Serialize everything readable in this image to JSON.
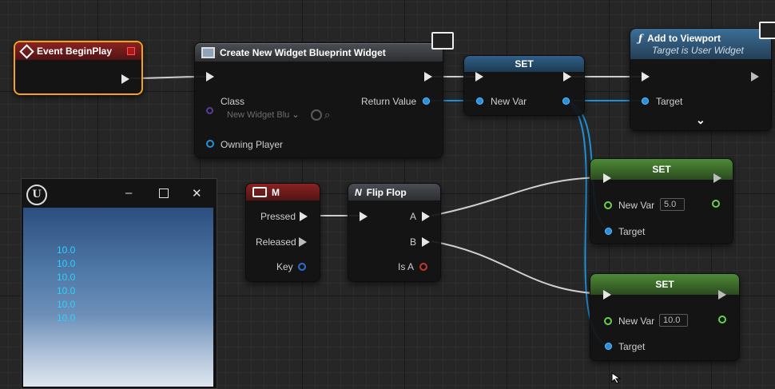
{
  "nodes": {
    "begin_play": {
      "title": "Event BeginPlay"
    },
    "create_widget": {
      "title": "Create New Widget Blueprint Widget",
      "class_label": "Class",
      "class_value": "New Widget Blu",
      "return_value_label": "Return Value",
      "owning_player_label": "Owning Player"
    },
    "set_top": {
      "title": "SET",
      "new_var_label": "New Var"
    },
    "add_to_viewport": {
      "title": "Add to Viewport",
      "subtitle": "Target is User Widget",
      "target_label": "Target",
      "expand_icon": "chevron-down"
    },
    "set_a": {
      "title": "SET",
      "new_var_label": "New Var",
      "new_var_value": "5.0",
      "target_label": "Target"
    },
    "set_b": {
      "title": "SET",
      "new_var_label": "New Var",
      "new_var_value": "10.0",
      "target_label": "Target"
    },
    "key_m": {
      "title": "M",
      "pressed_label": "Pressed",
      "released_label": "Released",
      "key_label": "Key"
    },
    "flip_flop": {
      "title": "Flip Flop",
      "a_label": "A",
      "b_label": "B",
      "is_a_label": "Is A"
    }
  },
  "preview_window": {
    "logo": "U",
    "values": [
      "10.0",
      "10.0",
      "10.0",
      "10.0",
      "10.0",
      "10.0"
    ]
  },
  "colors": {
    "exec_wire": "#cfcfcf",
    "object_wire": "#1f8fd8",
    "float_pin": "#69d04a",
    "selection": "#f5a219"
  }
}
